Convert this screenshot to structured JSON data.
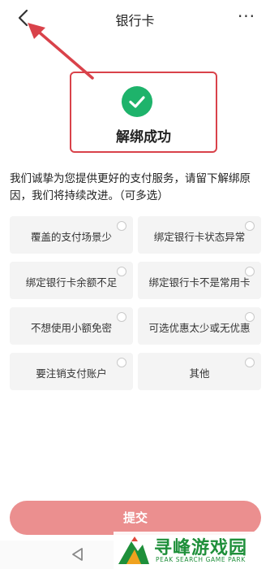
{
  "header": {
    "title": "银行卡",
    "more_label": "···"
  },
  "success": {
    "text": "解绑成功"
  },
  "description": "我们诚挚为您提供更好的支付服务，请留下解绑原因，我们将持续改进。（可多选）",
  "options": [
    {
      "label": "覆盖的支付场景少",
      "selected": false
    },
    {
      "label": "绑定银行卡状态异常",
      "selected": false
    },
    {
      "label": "绑定银行卡余额不足",
      "selected": false
    },
    {
      "label": "绑定银行卡不是常用卡",
      "selected": false
    },
    {
      "label": "不想使用小额免密",
      "selected": false
    },
    {
      "label": "可选优惠太少或无优惠",
      "selected": false
    },
    {
      "label": "要注销支付账户",
      "selected": false
    },
    {
      "label": "其他",
      "selected": false
    }
  ],
  "submit_label": "提交",
  "watermark": {
    "main": "寻峰游戏园",
    "sub": "PEAK SEARCH GAME PARK"
  },
  "colors": {
    "accent_red": "#d9424a",
    "success_green": "#1eb36b",
    "submit_bg": "#eb8f8f",
    "watermark_green": "#1e8f3a"
  }
}
